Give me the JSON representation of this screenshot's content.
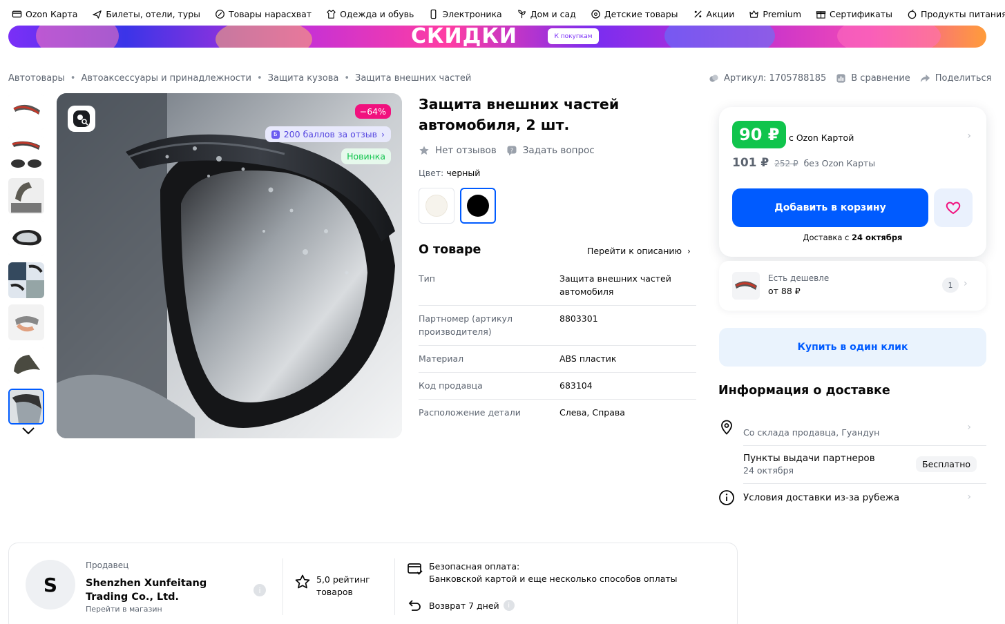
{
  "topnav": [
    {
      "label": "Ozon Карта",
      "icon": "card-icon"
    },
    {
      "label": "Билеты, отели, туры",
      "icon": "plane-icon"
    },
    {
      "label": "Товары нарасхват",
      "icon": "percent-badge-icon"
    },
    {
      "label": "Одежда и обувь",
      "icon": "clothes-icon"
    },
    {
      "label": "Электроника",
      "icon": "phone-icon"
    },
    {
      "label": "Дом и сад",
      "icon": "plant-icon"
    },
    {
      "label": "Детские товары",
      "icon": "pacifier-icon"
    },
    {
      "label": "Акции",
      "icon": "percent-icon"
    },
    {
      "label": "Premium",
      "icon": "crown-icon"
    },
    {
      "label": "Сертификаты",
      "icon": "gift-icon"
    },
    {
      "label": "Продукты питания",
      "icon": "food-icon"
    }
  ],
  "banner": {
    "title": "СКИДКИ",
    "button": "К покупкам"
  },
  "breadcrumb": [
    "Автотовары",
    "Автоаксессуары и принадлежности",
    "Защита кузова",
    "Защита внешних частей"
  ],
  "actions": {
    "article": "Артикул: 1705788185",
    "compare": "В сравнение",
    "share": "Поделиться"
  },
  "gallery": {
    "discount": "−64%",
    "bonus": "200 баллов за отзыв",
    "new_badge": "Новинка"
  },
  "product": {
    "title": "Защита внешних частей автомобиля, 2 шт.",
    "reviews": "Нет отзывов",
    "ask": "Задать вопрос",
    "color_label": "Цвет:",
    "color_value": "черный",
    "swatch_colors": [
      "#f6f3ec",
      "#000000"
    ]
  },
  "about": {
    "title": "О товаре",
    "to_description": "Перейти к описанию",
    "specs": [
      {
        "k": "Тип",
        "v": "Защита внешних частей автомобиля"
      },
      {
        "k": "Партномер (артикул производителя)",
        "v": "8803301"
      },
      {
        "k": "Материал",
        "v": "ABS пластик"
      },
      {
        "k": "Код продавца",
        "v": "683104"
      },
      {
        "k": "Расположение детали",
        "v": "Слева, Справа"
      }
    ]
  },
  "price": {
    "ozon_card_price": "90 ₽",
    "ozon_card_note": "с Ozon Картой",
    "regular_price": "101 ₽",
    "old_price": "252 ₽",
    "regular_note": "без Ozon Карты",
    "add_to_cart": "Добавить в корзину",
    "delivery_prefix": "Доставка с",
    "delivery_date": "24 октября"
  },
  "cheaper": {
    "label": "Есть дешевле",
    "price": "от 88 ₽",
    "count": "1"
  },
  "one_click": "Купить в один клик",
  "delivery": {
    "title": "Информация о доставке",
    "from": "Со склада продавца, Гуандун",
    "pickup": "Пункты выдачи партнеров",
    "pickup_date": "24 октября",
    "pickup_price": "Бесплатно",
    "abroad": "Условия доставки из-за рубежа"
  },
  "seller": {
    "avatar_letter": "S",
    "label": "Продавец",
    "name": "Shenzhen Xunfeitang Trading Co., Ltd.",
    "goto": "Перейти в магазин",
    "rating": "5,0 рейтинг товаров",
    "payment_title": "Безопасная оплата:",
    "payment_desc": "Банковской картой и еще несколько способов оплаты",
    "return": "Возврат 7 дней"
  },
  "colors": {
    "brand_blue": "#005bff",
    "green": "#10c44c",
    "pink": "#f1117e"
  }
}
